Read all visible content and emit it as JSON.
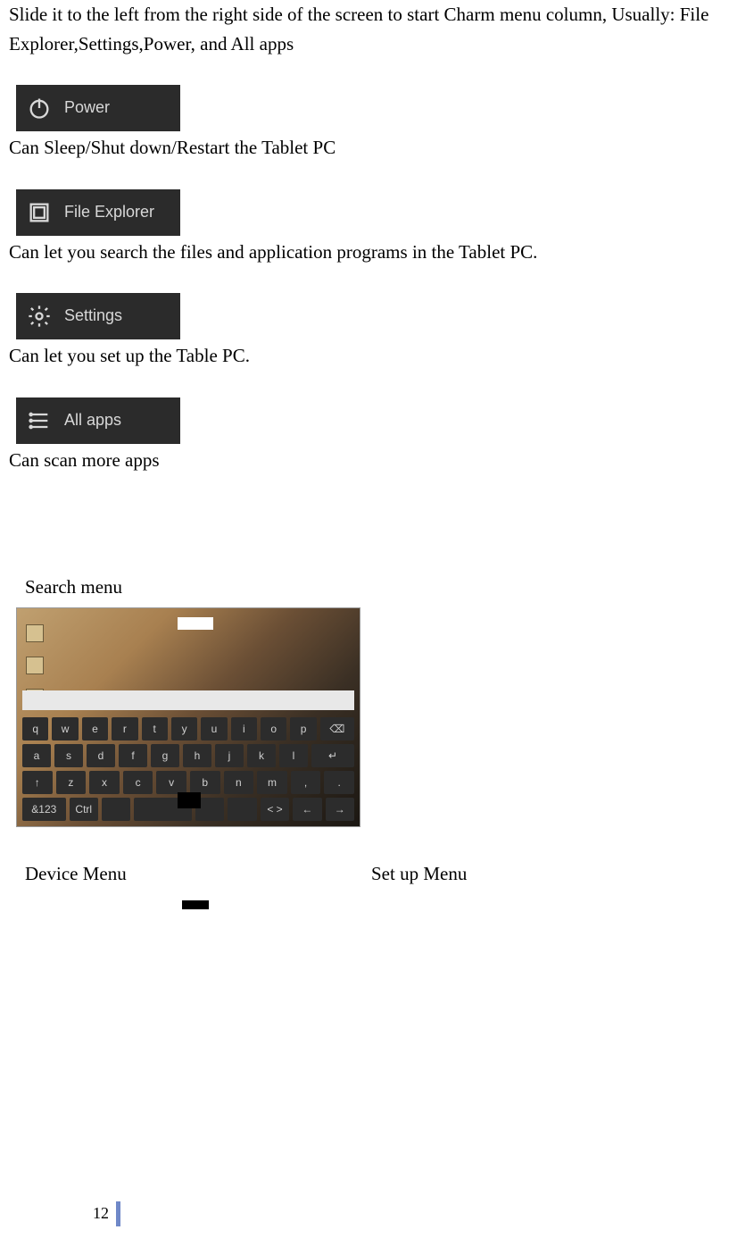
{
  "intro": "Slide it to the left from the right side of the screen to start Charm menu column, Usually: File Explorer,Settings,Power, and All apps",
  "items": [
    {
      "label": "Power",
      "desc": "Can Sleep/Shut down/Restart the Tablet PC"
    },
    {
      "label": "File Explorer",
      "desc": "Can let you search the files and application programs in the Tablet PC."
    },
    {
      "label": "Settings",
      "desc": "Can let you set up the Table PC."
    },
    {
      "label": "All apps",
      "desc": "Can scan more apps"
    }
  ],
  "search_label": "Search menu",
  "device_label": "Device Menu",
  "setup_label": "Set up Menu",
  "keyboard": {
    "search_hint": "",
    "row1": [
      "q",
      "w",
      "e",
      "r",
      "t",
      "y",
      "u",
      "i",
      "o",
      "p"
    ],
    "row2": [
      "a",
      "s",
      "d",
      "f",
      "g",
      "h",
      "j",
      "k",
      "l"
    ],
    "row3": [
      "↑",
      "z",
      "x",
      "c",
      "v",
      "b",
      "n",
      "m",
      ",",
      "."
    ],
    "row4": [
      "&123",
      "Ctrl",
      "",
      "",
      "",
      "",
      "< >",
      "←",
      "→"
    ],
    "del": "⌫",
    "enter": "↵"
  },
  "page_number": "12"
}
